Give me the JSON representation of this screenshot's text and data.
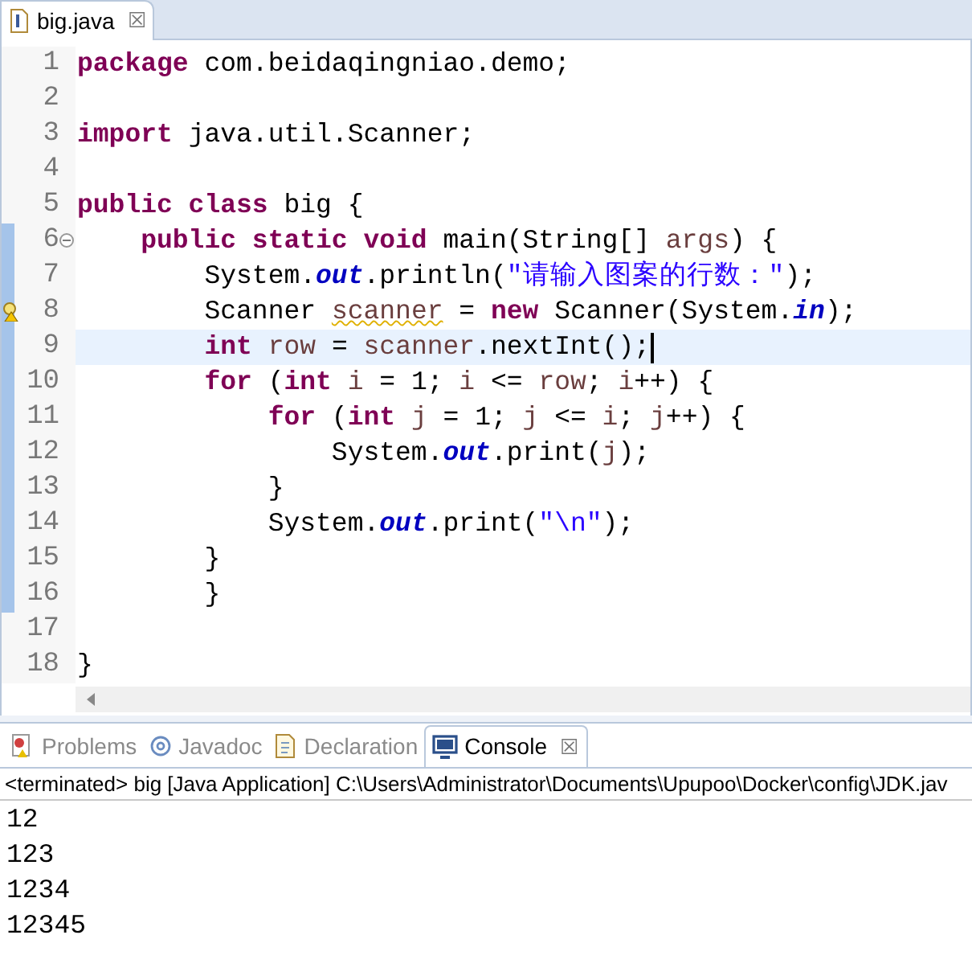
{
  "editor": {
    "tab": {
      "title": "big.java",
      "close": "☒"
    },
    "lines": [
      {
        "number": "1",
        "changed": false,
        "warning": false,
        "foldable": false,
        "current": false,
        "tokens": [
          {
            "kind": "keyword",
            "text": "package"
          },
          {
            "kind": "plain",
            "text": " com.beidaqingniao.demo;"
          }
        ]
      },
      {
        "number": "2",
        "changed": false,
        "warning": false,
        "foldable": false,
        "current": false
      },
      {
        "number": "3",
        "changed": false,
        "warning": false,
        "foldable": false,
        "current": false,
        "tokens": [
          {
            "kind": "keyword",
            "text": "import"
          },
          {
            "kind": "plain",
            "text": " java.util.Scanner;"
          }
        ]
      },
      {
        "number": "4",
        "changed": false,
        "warning": false,
        "foldable": false,
        "current": false
      },
      {
        "number": "5",
        "changed": false,
        "warning": false,
        "foldable": false,
        "current": false,
        "tokens": [
          {
            "kind": "keyword",
            "text": "public class"
          },
          {
            "kind": "plain",
            "text": " big {"
          }
        ]
      },
      {
        "number": "6",
        "changed": true,
        "warning": false,
        "foldable": true,
        "current": false,
        "tokens": [
          {
            "kind": "keyword",
            "text": "    public static void"
          },
          {
            "kind": "plain",
            "text": " main(String[] "
          },
          {
            "kind": "local",
            "text": "args"
          },
          {
            "kind": "plain",
            "text": ") {"
          }
        ]
      },
      {
        "number": "7",
        "changed": true,
        "warning": false,
        "foldable": false,
        "current": false,
        "tokens": [
          {
            "kind": "plain",
            "text": "        System."
          },
          {
            "kind": "field",
            "text": "out"
          },
          {
            "kind": "plain",
            "text": ".println("
          },
          {
            "kind": "string",
            "text": "\"请输入图案的行数：\""
          },
          {
            "kind": "plain",
            "text": ");"
          }
        ]
      },
      {
        "number": "8",
        "changed": true,
        "warning": true,
        "foldable": false,
        "current": false,
        "tokens": [
          {
            "kind": "plain",
            "text": "        Scanner "
          },
          {
            "kind": "local",
            "text": "scanner",
            "warning": true
          },
          {
            "kind": "plain",
            "text": " = "
          },
          {
            "kind": "keyword",
            "text": "new"
          },
          {
            "kind": "plain",
            "text": " Scanner(System."
          },
          {
            "kind": "field",
            "text": "in"
          },
          {
            "kind": "plain",
            "text": ");"
          }
        ]
      },
      {
        "number": "9",
        "changed": true,
        "warning": false,
        "foldable": false,
        "current": true,
        "tokens": [
          {
            "kind": "keyword",
            "text": "        int "
          },
          {
            "kind": "local",
            "text": "row"
          },
          {
            "kind": "plain",
            "text": " = "
          },
          {
            "kind": "local",
            "text": "scanner"
          },
          {
            "kind": "plain",
            "text": ".nextInt();"
          }
        ]
      },
      {
        "number": "10",
        "changed": true,
        "warning": false,
        "foldable": false,
        "current": false,
        "tokens": [
          {
            "kind": "keyword",
            "text": "        for"
          },
          {
            "kind": "plain",
            "text": " ("
          },
          {
            "kind": "keyword",
            "text": "int "
          },
          {
            "kind": "local",
            "text": "i"
          },
          {
            "kind": "plain",
            "text": " = 1; "
          },
          {
            "kind": "local",
            "text": "i"
          },
          {
            "kind": "plain",
            "text": " <= "
          },
          {
            "kind": "local",
            "text": "row"
          },
          {
            "kind": "plain",
            "text": "; "
          },
          {
            "kind": "local",
            "text": "i"
          },
          {
            "kind": "plain",
            "text": "++) {"
          }
        ]
      },
      {
        "number": "11",
        "changed": true,
        "warning": false,
        "foldable": false,
        "current": false,
        "tokens": [
          {
            "kind": "keyword",
            "text": "            for"
          },
          {
            "kind": "plain",
            "text": " ("
          },
          {
            "kind": "keyword",
            "text": "int "
          },
          {
            "kind": "local",
            "text": "j"
          },
          {
            "kind": "plain",
            "text": " = 1; "
          },
          {
            "kind": "local",
            "text": "j"
          },
          {
            "kind": "plain",
            "text": " <= "
          },
          {
            "kind": "local",
            "text": "i"
          },
          {
            "kind": "plain",
            "text": "; "
          },
          {
            "kind": "local",
            "text": "j"
          },
          {
            "kind": "plain",
            "text": "++) {"
          }
        ]
      },
      {
        "number": "12",
        "changed": true,
        "warning": false,
        "foldable": false,
        "current": false,
        "tokens": [
          {
            "kind": "plain",
            "text": "                System."
          },
          {
            "kind": "field",
            "text": "out"
          },
          {
            "kind": "plain",
            "text": ".print("
          },
          {
            "kind": "local",
            "text": "j"
          },
          {
            "kind": "plain",
            "text": ");"
          }
        ]
      },
      {
        "number": "13",
        "changed": true,
        "warning": false,
        "foldable": false,
        "current": false,
        "tokens": [
          {
            "kind": "plain",
            "text": "            }"
          }
        ]
      },
      {
        "number": "14",
        "changed": true,
        "warning": false,
        "foldable": false,
        "current": false,
        "tokens": [
          {
            "kind": "plain",
            "text": "            System."
          },
          {
            "kind": "field",
            "text": "out"
          },
          {
            "kind": "plain",
            "text": ".print("
          },
          {
            "kind": "string",
            "text": "\"\\n\""
          },
          {
            "kind": "plain",
            "text": ");"
          }
        ]
      },
      {
        "number": "15",
        "changed": true,
        "warning": false,
        "foldable": false,
        "current": false,
        "tokens": [
          {
            "kind": "plain",
            "text": "        }"
          }
        ]
      },
      {
        "number": "16",
        "changed": true,
        "warning": false,
        "foldable": false,
        "current": false,
        "tokens": [
          {
            "kind": "plain",
            "text": "        }"
          }
        ]
      },
      {
        "number": "17",
        "changed": false,
        "warning": false,
        "foldable": false,
        "current": false
      },
      {
        "number": "18",
        "changed": false,
        "warning": false,
        "foldable": false,
        "current": false,
        "tokens": [
          {
            "kind": "plain",
            "text": "}"
          }
        ]
      }
    ]
  },
  "bottom_panel": {
    "tabs": [
      {
        "label": "Problems",
        "kind": "problems",
        "selected": false
      },
      {
        "label": "Javadoc",
        "kind": "javadoc",
        "selected": false
      },
      {
        "label": "Declaration",
        "kind": "declaration",
        "selected": false
      },
      {
        "label": "Console",
        "kind": "console",
        "selected": true,
        "close": "☒"
      }
    ],
    "console": {
      "header": "<terminated> big [Java Application] C:\\Users\\Administrator\\Documents\\Upupoo\\Docker\\config\\JDK.jav",
      "output": [
        "12",
        "123",
        "1234",
        "12345"
      ]
    }
  }
}
